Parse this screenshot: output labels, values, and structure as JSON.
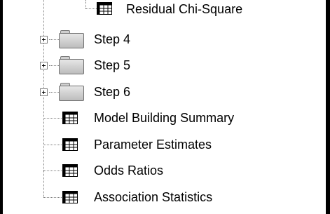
{
  "tree": {
    "items": [
      {
        "label": "Residual Chi-Square",
        "icon": "table-icon"
      },
      {
        "label": "Step 4",
        "icon": "folder-icon",
        "expander": "+"
      },
      {
        "label": "Step 5",
        "icon": "folder-icon",
        "expander": "+"
      },
      {
        "label": "Step 6",
        "icon": "folder-icon",
        "expander": "+"
      },
      {
        "label": "Model Building Summary",
        "icon": "table-icon"
      },
      {
        "label": "Parameter Estimates",
        "icon": "table-icon"
      },
      {
        "label": "Odds Ratios",
        "icon": "table-icon"
      },
      {
        "label": "Association Statistics",
        "icon": "table-icon"
      }
    ]
  },
  "colors": {
    "text": "#000000",
    "tree_lines": "#808080",
    "folder_fill": "#cccccc",
    "icon_dark": "#000000",
    "frame_border": "#000000"
  }
}
